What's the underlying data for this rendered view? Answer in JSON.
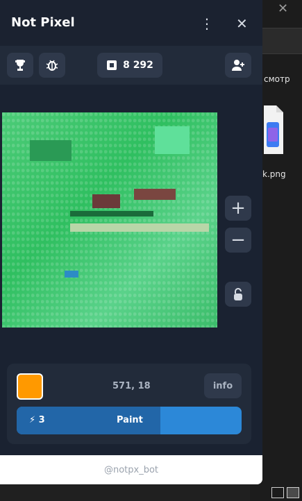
{
  "background": {
    "context_text": "смотр",
    "file_name": "k.png"
  },
  "app": {
    "title": "Not Pixel",
    "menu_icon": "more-vertical-icon",
    "close_icon": "close-icon"
  },
  "toolbar": {
    "trophy_icon": "trophy-icon",
    "bug_icon": "bug-icon",
    "balance_icon": "pixel-square-icon",
    "balance": "8 292",
    "invite_icon": "add-user-icon"
  },
  "controls": {
    "zoom_in": "+",
    "zoom_out": "−",
    "lock_icon": "unlock-icon"
  },
  "panel": {
    "selected_color": "#ff9900",
    "coords": "571, 18",
    "info_label": "info",
    "energy": "3",
    "energy_icon": "bolt-icon",
    "paint_label": "Paint",
    "paint_progress": 0.64
  },
  "footer": {
    "bot": "@notpx_bot"
  }
}
